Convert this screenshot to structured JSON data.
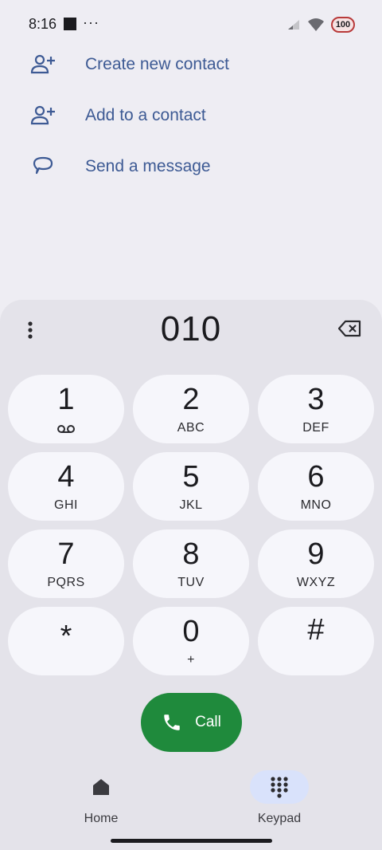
{
  "status_bar": {
    "time": "8:16",
    "dots": "···",
    "battery_level": "100"
  },
  "actions": [
    {
      "label": "Create new contact",
      "icon": "person-add-icon"
    },
    {
      "label": "Add to a contact",
      "icon": "person-add-icon"
    },
    {
      "label": "Send a message",
      "icon": "message-icon"
    }
  ],
  "dialer": {
    "number": "010",
    "keys": [
      {
        "num": "1",
        "sub": ""
      },
      {
        "num": "2",
        "sub": "ABC"
      },
      {
        "num": "3",
        "sub": "DEF"
      },
      {
        "num": "4",
        "sub": "GHI"
      },
      {
        "num": "5",
        "sub": "JKL"
      },
      {
        "num": "6",
        "sub": "MNO"
      },
      {
        "num": "7",
        "sub": "PQRS"
      },
      {
        "num": "8",
        "sub": "TUV"
      },
      {
        "num": "9",
        "sub": "WXYZ"
      },
      {
        "num": "*",
        "sub": ""
      },
      {
        "num": "0",
        "sub": "+"
      },
      {
        "num": "#",
        "sub": ""
      }
    ],
    "call_label": "Call",
    "call_color": "#1f8a3c"
  },
  "nav": {
    "home_label": "Home",
    "keypad_label": "Keypad"
  },
  "colors": {
    "accent_text": "#3d5a94",
    "active_pill": "#d9e2fb"
  }
}
